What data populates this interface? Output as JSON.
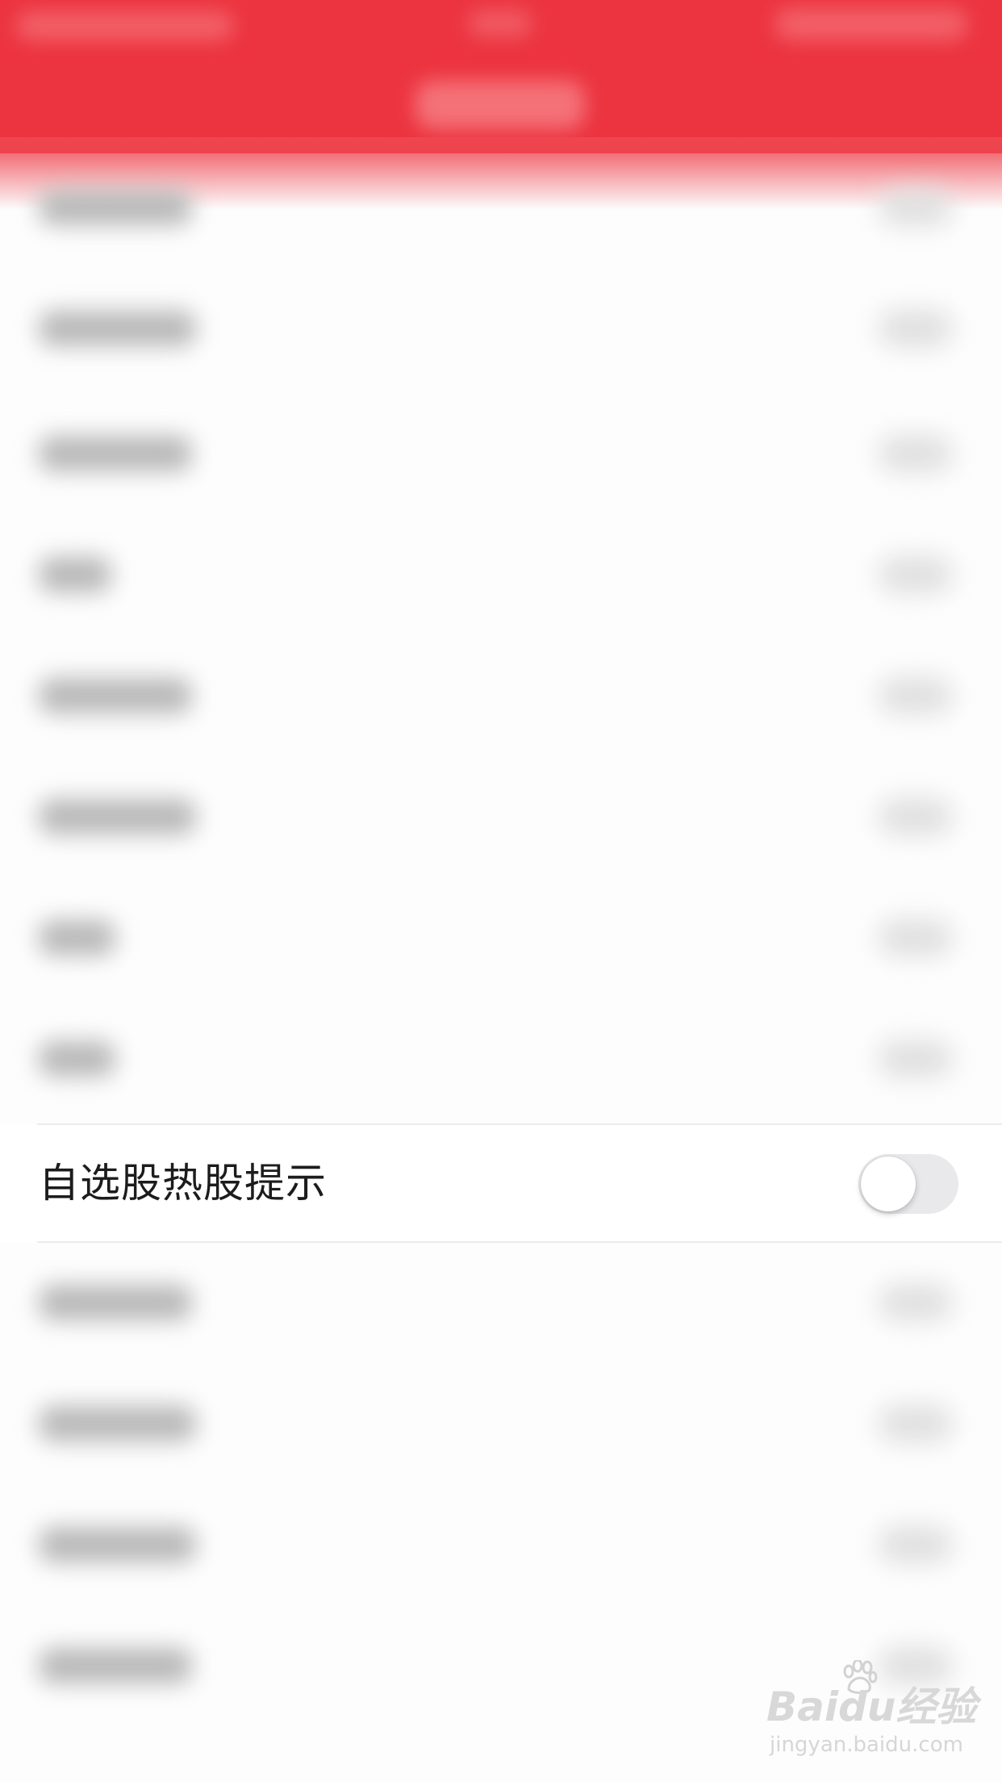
{
  "settings": {
    "highlighted_item": {
      "label": "自选股热股提示",
      "toggle_on": false
    }
  },
  "colors": {
    "header": "#ec3440",
    "toggle_off_track": "#e9e9eb",
    "toggle_knob": "#ffffff",
    "text": "#1c1c1c"
  },
  "watermark": {
    "logo_text": "Baidu经验",
    "url": "jingyan.baidu.com"
  }
}
